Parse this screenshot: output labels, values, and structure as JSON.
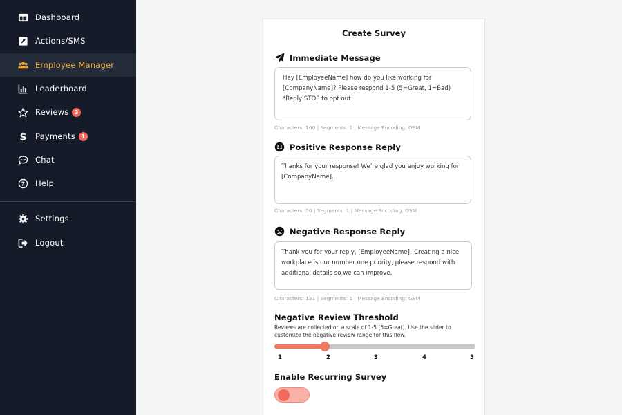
{
  "sidebar": {
    "items": [
      {
        "label": "Dashboard",
        "icon": "dashboard-icon"
      },
      {
        "label": "Actions/SMS",
        "icon": "edit-icon"
      },
      {
        "label": "Employee Manager",
        "icon": "users-icon",
        "active": true
      },
      {
        "label": "Leaderboard",
        "icon": "bar-chart-icon"
      },
      {
        "label": "Reviews",
        "icon": "star-icon",
        "badge": "3"
      },
      {
        "label": "Payments",
        "icon": "dollar-icon",
        "badge": "1"
      },
      {
        "label": "Chat",
        "icon": "chat-icon"
      },
      {
        "label": "Help",
        "icon": "help-icon"
      },
      {
        "label": "Settings",
        "icon": "gear-icon"
      },
      {
        "label": "Logout",
        "icon": "logout-icon"
      }
    ]
  },
  "survey": {
    "title": "Create Survey",
    "immediate": {
      "title": "Immediate Message",
      "text": "Hey [EmployeeName] how do you like working for [CompanyName]? Please respond 1-5 (5=Great, 1=Bad)\n*Reply STOP to opt out",
      "meta": "Characters: 160 | Segments: 1 | Message Encoding: GSM"
    },
    "positive": {
      "title": "Positive Response Reply",
      "text": "Thanks for your response! We’re glad you enjoy working for [CompanyName].",
      "meta": "Characters: 50 | Segments: 1 | Message Encoding: GSM"
    },
    "negative": {
      "title": "Negative Response Reply",
      "text": "Thank you for your reply, [EmployeeName]! Creating a nice workplace is our number one priority, please respond with additional details so we can improve.",
      "meta": "Characters: 121 | Segments: 1 | Message Encoding: GSM"
    },
    "threshold": {
      "title": "Negative Review Threshold",
      "description": "Reviews are collected on a scale of 1-5 (5=Great). Use the slider to customize the negative review range for this flow.",
      "ticks": [
        "1",
        "2",
        "3",
        "4",
        "5"
      ],
      "min": 1,
      "max": 5,
      "value": 2
    },
    "recurring": {
      "title": "Enable Recurring Survey",
      "enabled": true
    }
  },
  "colors": {
    "sidebar_bg": "#151b29",
    "active_accent": "#f0a93d",
    "badge": "#ef6a5b",
    "slider": "#ef7a62"
  }
}
